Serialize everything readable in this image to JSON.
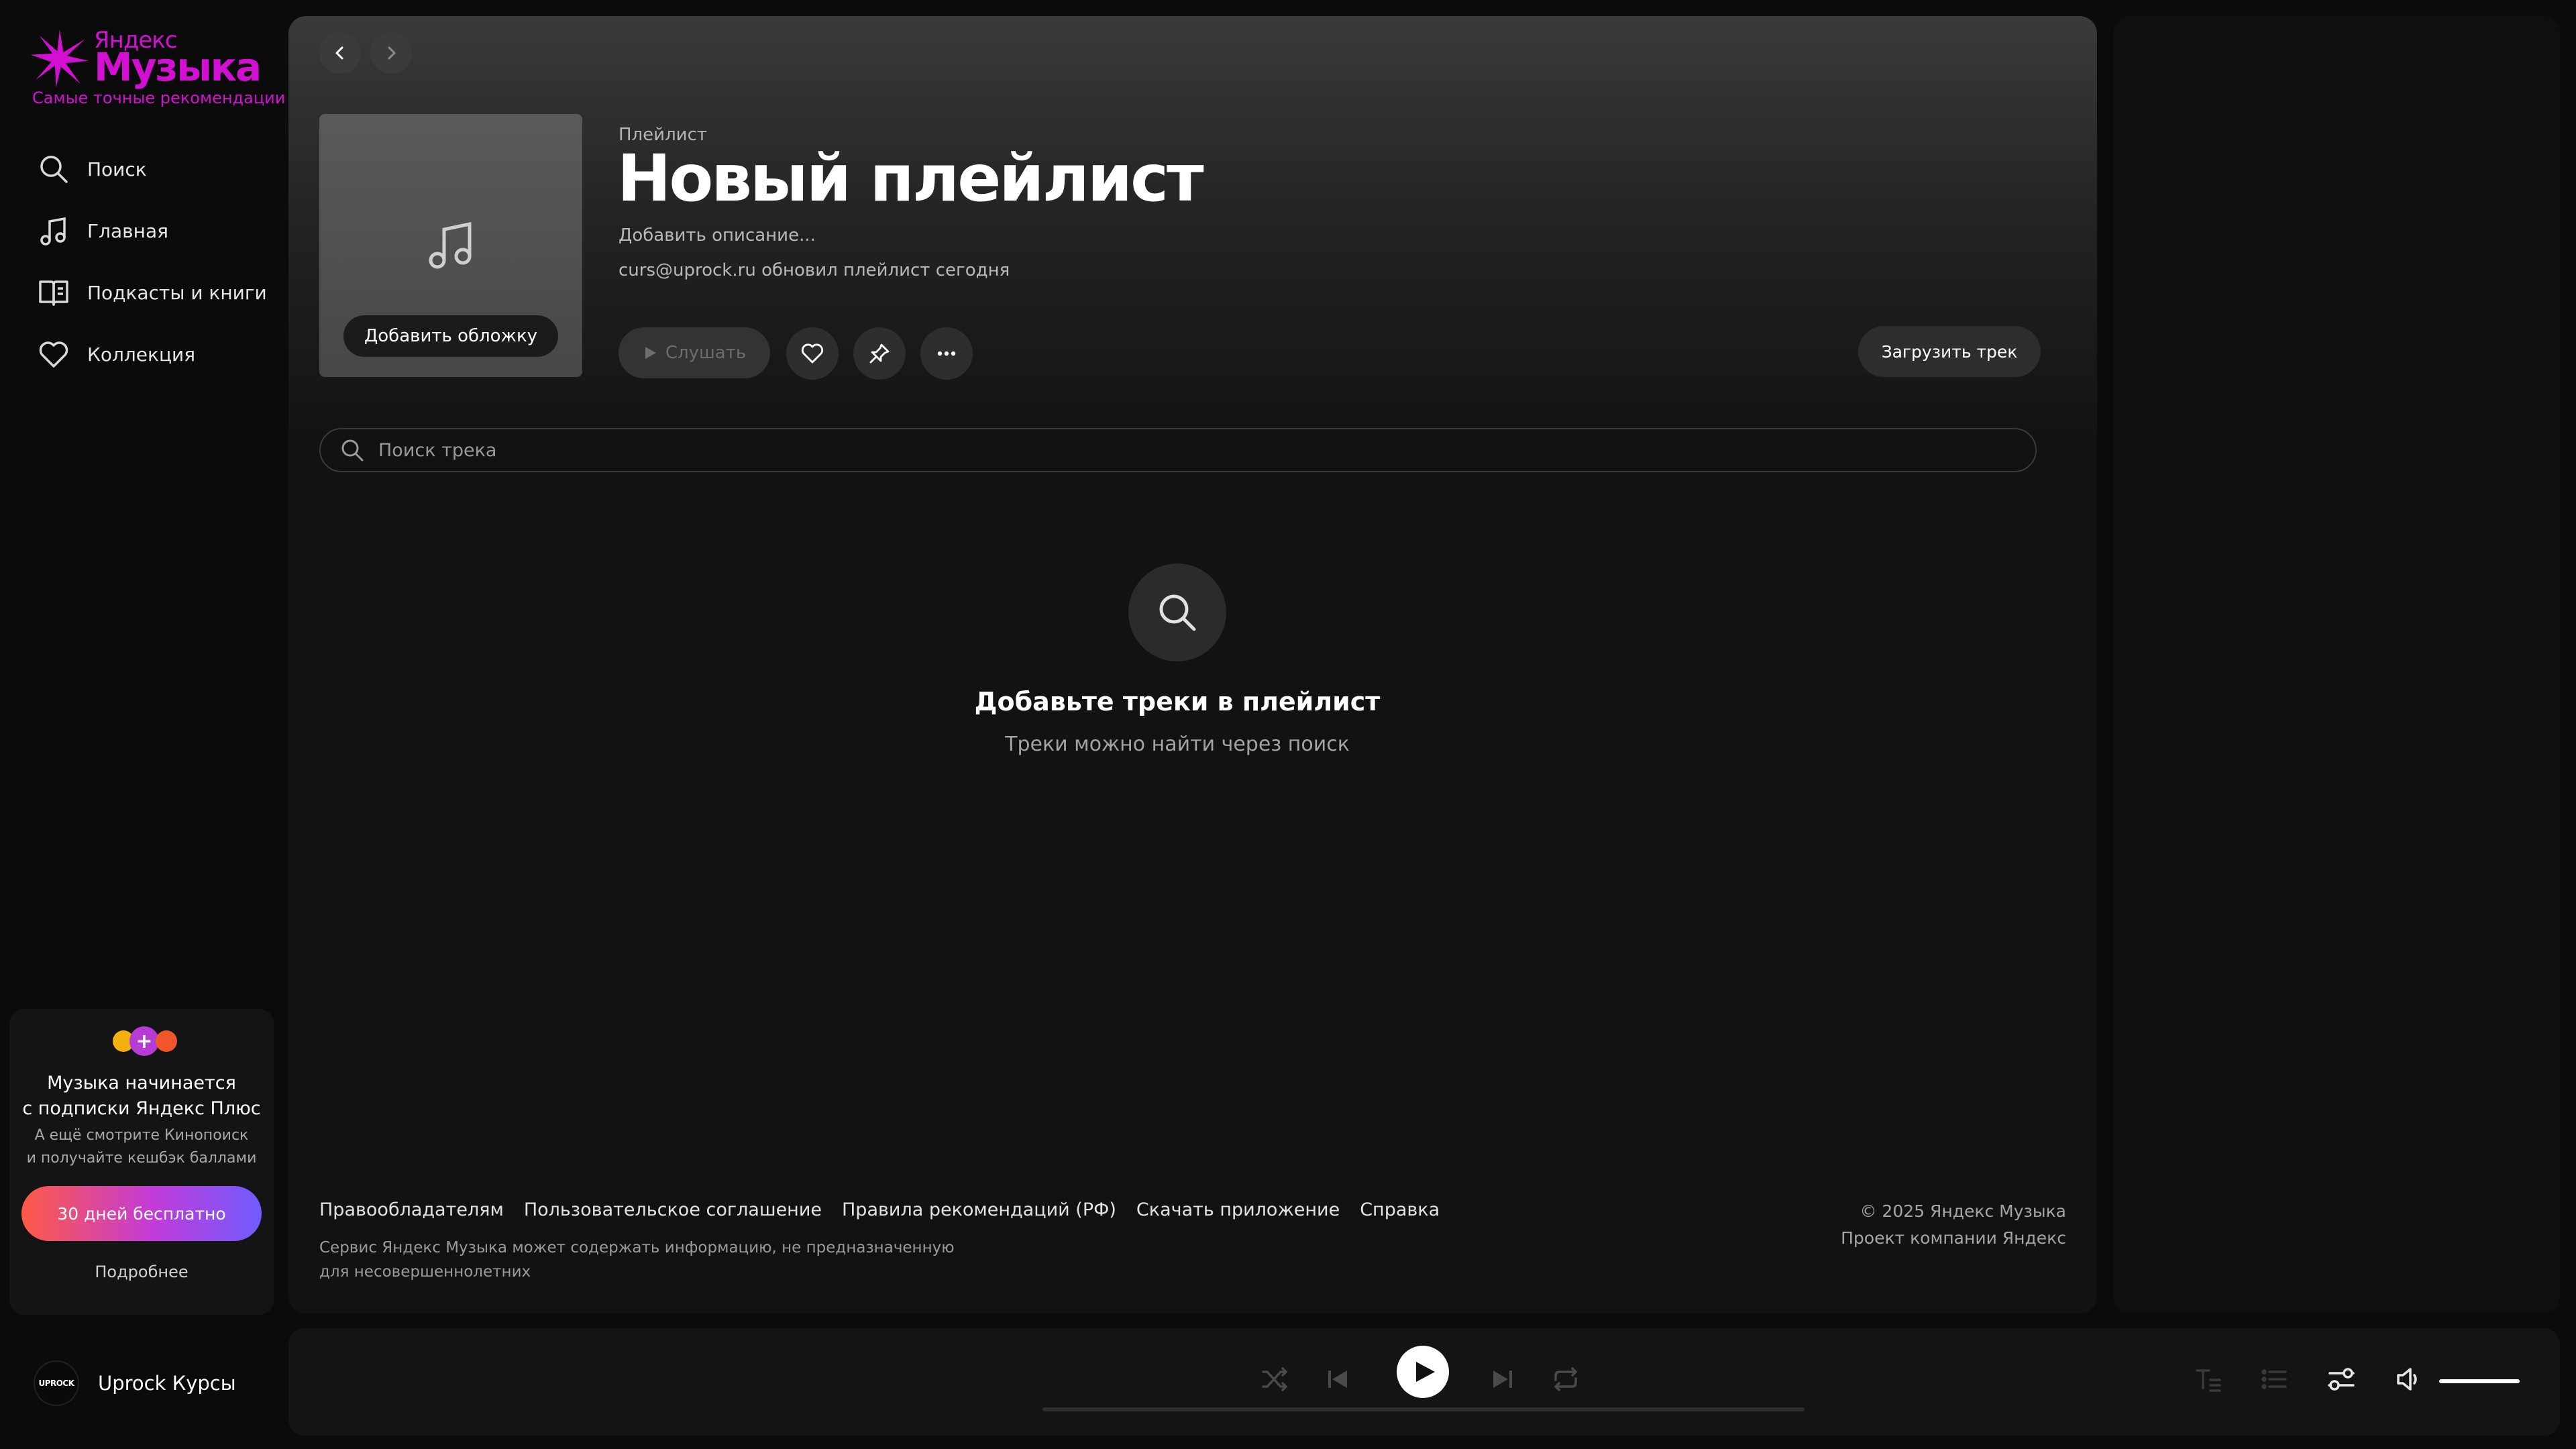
{
  "logo": {
    "small": "Яндекс",
    "big": "Музыка",
    "tagline": "Самые точные рекомендации"
  },
  "nav": [
    {
      "label": "Поиск",
      "icon": "search-icon"
    },
    {
      "label": "Главная",
      "icon": "music-note-icon"
    },
    {
      "label": "Подкасты и книги",
      "icon": "book-icon"
    },
    {
      "label": "Коллекция",
      "icon": "heart-icon"
    }
  ],
  "promo": {
    "title_line1": "Музыка начинается",
    "title_line2": "с подписки Яндекс Плюс",
    "sub_line1": "А ещё смотрите Кинопоиск",
    "sub_line2": "и получайте кешбэк баллами",
    "button": "30 дней бесплатно",
    "more": "Подробнее"
  },
  "user": {
    "avatar_text": "UPROCK",
    "name": "Uprock Курсы"
  },
  "playlist": {
    "kind": "Плейлист",
    "title": "Новый плейлист",
    "description": "Добавить описание...",
    "meta": "curs@uprock.ru обновил плейлист сегодня",
    "cover_button": "Добавить обложку",
    "listen_button": "Слушать",
    "upload_button": "Загрузить трек"
  },
  "search": {
    "placeholder": "Поиск трека"
  },
  "empty": {
    "title": "Добавьте треки в плейлист",
    "subtitle": "Треки можно найти через поиск"
  },
  "footer": {
    "links": [
      "Правообладателям",
      "Пользовательское соглашение",
      "Правила рекомендаций (РФ)",
      "Скачать приложение",
      "Справка"
    ],
    "note_line1": "Сервис Яндекс Музыка может содержать информацию, не предназначенную",
    "note_line2": "для несовершеннолетних",
    "copyright": "© 2025  Яндекс Музыка",
    "company": "Проект компании Яндекс"
  },
  "colors": {
    "brand": "#d20fd2",
    "background": "#0b0b0b",
    "panel": "#121212"
  }
}
